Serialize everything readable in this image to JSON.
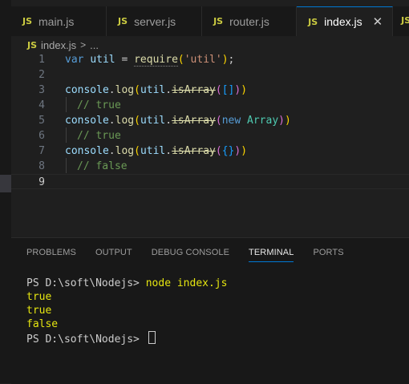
{
  "tabs": [
    {
      "icon": "JS",
      "label": "main.js"
    },
    {
      "icon": "JS",
      "label": "server.js"
    },
    {
      "icon": "JS",
      "label": "router.js"
    },
    {
      "icon": "JS",
      "label": "index.js",
      "active": true
    }
  ],
  "tab_edge_icon": "JS",
  "close_glyph": "✕",
  "breadcrumb": {
    "icon": "JS",
    "file": "index.js",
    "sep": ">",
    "more": "..."
  },
  "editor": {
    "line_numbers": [
      "1",
      "2",
      "3",
      "4",
      "5",
      "6",
      "7",
      "8",
      "9"
    ],
    "current_line": "9",
    "lines": {
      "l1": {
        "kw": "var",
        "var": "util",
        "eq": " = ",
        "fn": "require",
        "open": "(",
        "str": "'util'",
        "close": ")",
        "semi": ";"
      },
      "l3": {
        "obj": "console",
        "dot": ".",
        "fn": "log",
        "o1": "(",
        "var": "util",
        "dot2": ".",
        "fn2": "isArray",
        "o2": "(",
        "arr": "[]",
        "c2": ")",
        "c1": ")"
      },
      "l4": {
        "comment": "// true"
      },
      "l5": {
        "obj": "console",
        "dot": ".",
        "fn": "log",
        "o1": "(",
        "var": "util",
        "dot2": ".",
        "fn2": "isArray",
        "o2": "(",
        "kw": "new",
        "cls": "Array",
        "c2": ")",
        "c1": ")"
      },
      "l6": {
        "comment": "// true"
      },
      "l7": {
        "obj": "console",
        "dot": ".",
        "fn": "log",
        "o1": "(",
        "var": "util",
        "dot2": ".",
        "fn2": "isArray",
        "o2": "(",
        "obj2": "{}",
        "c2": ")",
        "c1": ")"
      },
      "l8": {
        "comment": "// false"
      }
    }
  },
  "panel": {
    "tabs": [
      "PROBLEMS",
      "OUTPUT",
      "DEBUG CONSOLE",
      "TERMINAL",
      "PORTS"
    ],
    "active_tab": "TERMINAL"
  },
  "terminal": {
    "prompt": "PS D:\\soft\\Nodejs> ",
    "command": "node index.js",
    "output": [
      "true",
      "true",
      "false"
    ],
    "prompt2": "PS D:\\soft\\Nodejs> "
  },
  "colors": {
    "accent": "#0078d4",
    "js_icon": "#cbcb41",
    "terminal_command": "#e5e510"
  }
}
